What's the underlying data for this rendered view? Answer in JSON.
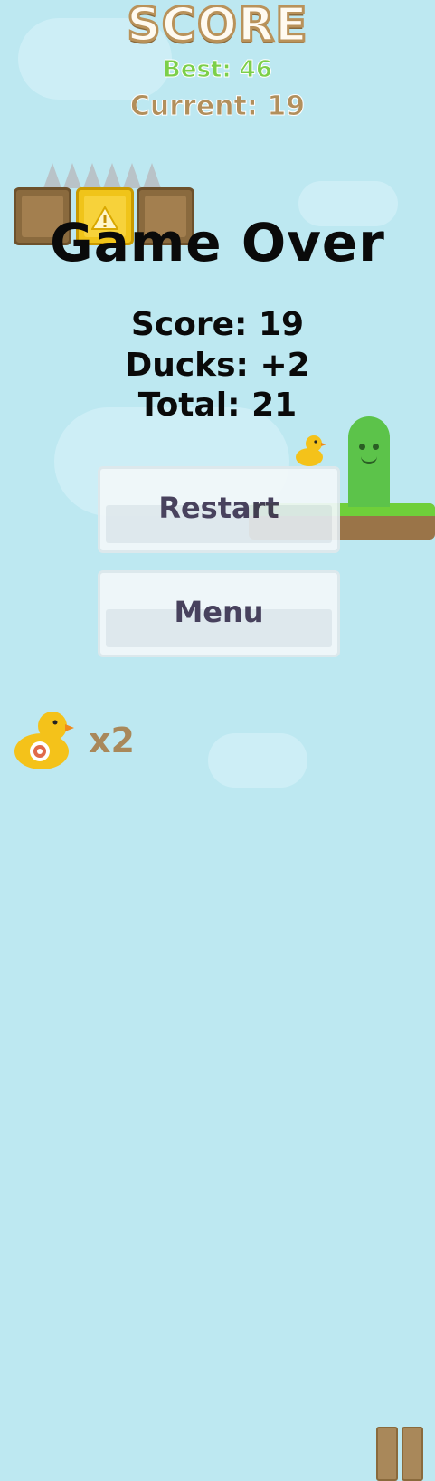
{
  "header": {
    "title": "SCORE",
    "best": "Best: 46",
    "current": "Current: 19"
  },
  "game_over": {
    "title": "Game Over",
    "score_line": "Score: 19",
    "ducks_line": "Ducks: +2",
    "total_line": "Total: 21"
  },
  "buttons": {
    "restart": "Restart",
    "menu": "Menu"
  },
  "footer": {
    "duck_multiplier": "x2"
  },
  "icons": {
    "duck": "duck-icon",
    "pause": "pause-icon",
    "warning": "warning-icon"
  },
  "colors": {
    "sky": "#bde8f1",
    "best_green": "#7ccf4a",
    "current_brown": "#b28f5c",
    "button_text": "#3f3552"
  }
}
